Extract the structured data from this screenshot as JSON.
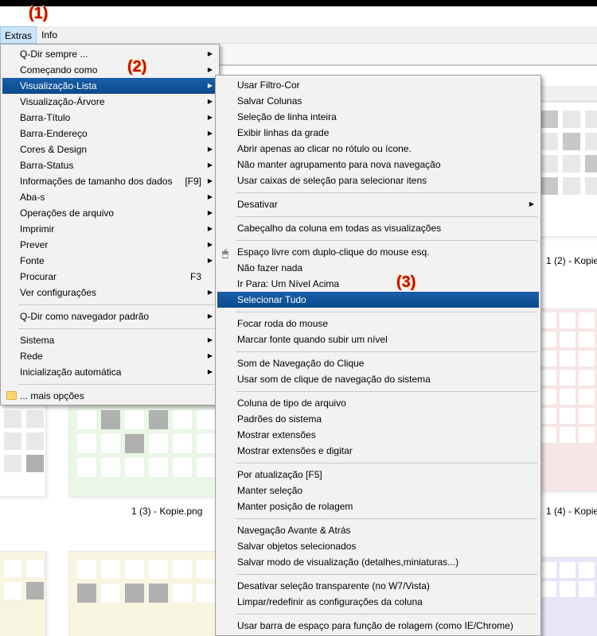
{
  "menubar": {
    "items": [
      {
        "label": "Extras"
      },
      {
        "label": "Info"
      }
    ]
  },
  "annotations": {
    "a1": "(1)",
    "a2": "(2)",
    "a3": "(3)"
  },
  "extras_menu": {
    "items": [
      {
        "label": "Q-Dir sempre ...",
        "shortcut": "",
        "arrow": "▶"
      },
      {
        "label": "Começando como",
        "shortcut": "",
        "arrow": "▶"
      },
      {
        "label": "Visualização-Lista",
        "shortcut": "",
        "arrow": "▶"
      },
      {
        "label": "Visualização-Árvore",
        "shortcut": "",
        "arrow": "▶"
      },
      {
        "label": "Barra-Título",
        "shortcut": "",
        "arrow": "▶"
      },
      {
        "label": "Barra-Endereço",
        "shortcut": "",
        "arrow": "▶"
      },
      {
        "label": "Cores & Design",
        "shortcut": "",
        "arrow": "▶"
      },
      {
        "label": "Barra-Status",
        "shortcut": "",
        "arrow": "▶"
      },
      {
        "label": "Informações de tamanho dos dados",
        "shortcut": "[F9]",
        "arrow": "▶"
      },
      {
        "label": "Aba-s",
        "shortcut": "",
        "arrow": "▶"
      },
      {
        "label": "Operações de arquivo",
        "shortcut": "",
        "arrow": "▶"
      },
      {
        "label": "Imprimir",
        "shortcut": "",
        "arrow": "▶"
      },
      {
        "label": "Prever",
        "shortcut": "",
        "arrow": "▶"
      },
      {
        "label": "Fonte",
        "shortcut": "",
        "arrow": "▶"
      },
      {
        "label": "Procurar",
        "shortcut": "F3",
        "arrow": "▶"
      },
      {
        "label": "Ver configurações",
        "shortcut": "",
        "arrow": "▶"
      },
      {
        "label": "Q-Dir como navegador padrão",
        "shortcut": "",
        "arrow": "▶"
      },
      {
        "label": "Sistema",
        "shortcut": "",
        "arrow": "▶"
      },
      {
        "label": "Rede",
        "shortcut": "",
        "arrow": "▶"
      },
      {
        "label": "Inicialização automática",
        "shortcut": "",
        "arrow": "▶"
      },
      {
        "label": "... mais opções",
        "shortcut": "",
        "arrow": ""
      }
    ]
  },
  "list_view_submenu": {
    "items": [
      {
        "label": "Usar Filtro-Cor"
      },
      {
        "label": "Salvar Colunas"
      },
      {
        "label": "Seleção de linha inteira"
      },
      {
        "label": "Exibir linhas da grade"
      },
      {
        "label": "Abrir apenas ao clicar no rótulo ou ícone."
      },
      {
        "label": "Não manter agrupamento para nova navegação"
      },
      {
        "label": "Usar caixas de seleção para selecionar itens"
      },
      {
        "label": "Desativar",
        "arrow": "▶"
      },
      {
        "label": "Cabeçalho da coluna em todas as visualizações"
      },
      {
        "label": "Espaço livre com duplo-clique do mouse esq."
      },
      {
        "label": "Não fazer nada"
      },
      {
        "label": "Ir Para: Um Nível Acima"
      },
      {
        "label": "Selecionar Tudo"
      },
      {
        "label": "Focar roda do mouse"
      },
      {
        "label": "Marcar fonte quando subir um nível"
      },
      {
        "label": "Som de Navegação do Clique"
      },
      {
        "label": "Usar som de clique de navegação do sistema"
      },
      {
        "label": "Coluna de tipo de arquivo"
      },
      {
        "label": "Padrões do sistema"
      },
      {
        "label": "Mostrar extensões"
      },
      {
        "label": "Mostrar extensões e digitar"
      },
      {
        "label": "Por atualização [F5]"
      },
      {
        "label": "Manter seleção"
      },
      {
        "label": "Manter posição de rolagem"
      },
      {
        "label": "Navegação Avante & Atrás"
      },
      {
        "label": "Salvar objetos selecionados"
      },
      {
        "label": "Salvar modo de visualização (detalhes,miniaturas...)"
      },
      {
        "label": "Desativar seleção transparente (no W7/Vista)"
      },
      {
        "label": "Limpar/redefinir as configurações da coluna"
      },
      {
        "label": "Usar barra de espaço para função de rolagem (como IE/Chrome)"
      }
    ]
  },
  "files": {
    "captions": [
      {
        "text": "1 (2) - Kopie"
      },
      {
        "text": "1 (3) - Kopie.png"
      },
      {
        "text": "1 (4) - Kopie"
      }
    ]
  },
  "colors": {
    "selection": "#0b4a8c",
    "annotation": "#cc0000",
    "thumb_gray": "#c8c8c8",
    "thumb_red": "#e8b0b0",
    "thumb_green": "#b8e0b0",
    "thumb_yellow": "#ece6b8",
    "thumb_blue": "#b8b8ec"
  }
}
